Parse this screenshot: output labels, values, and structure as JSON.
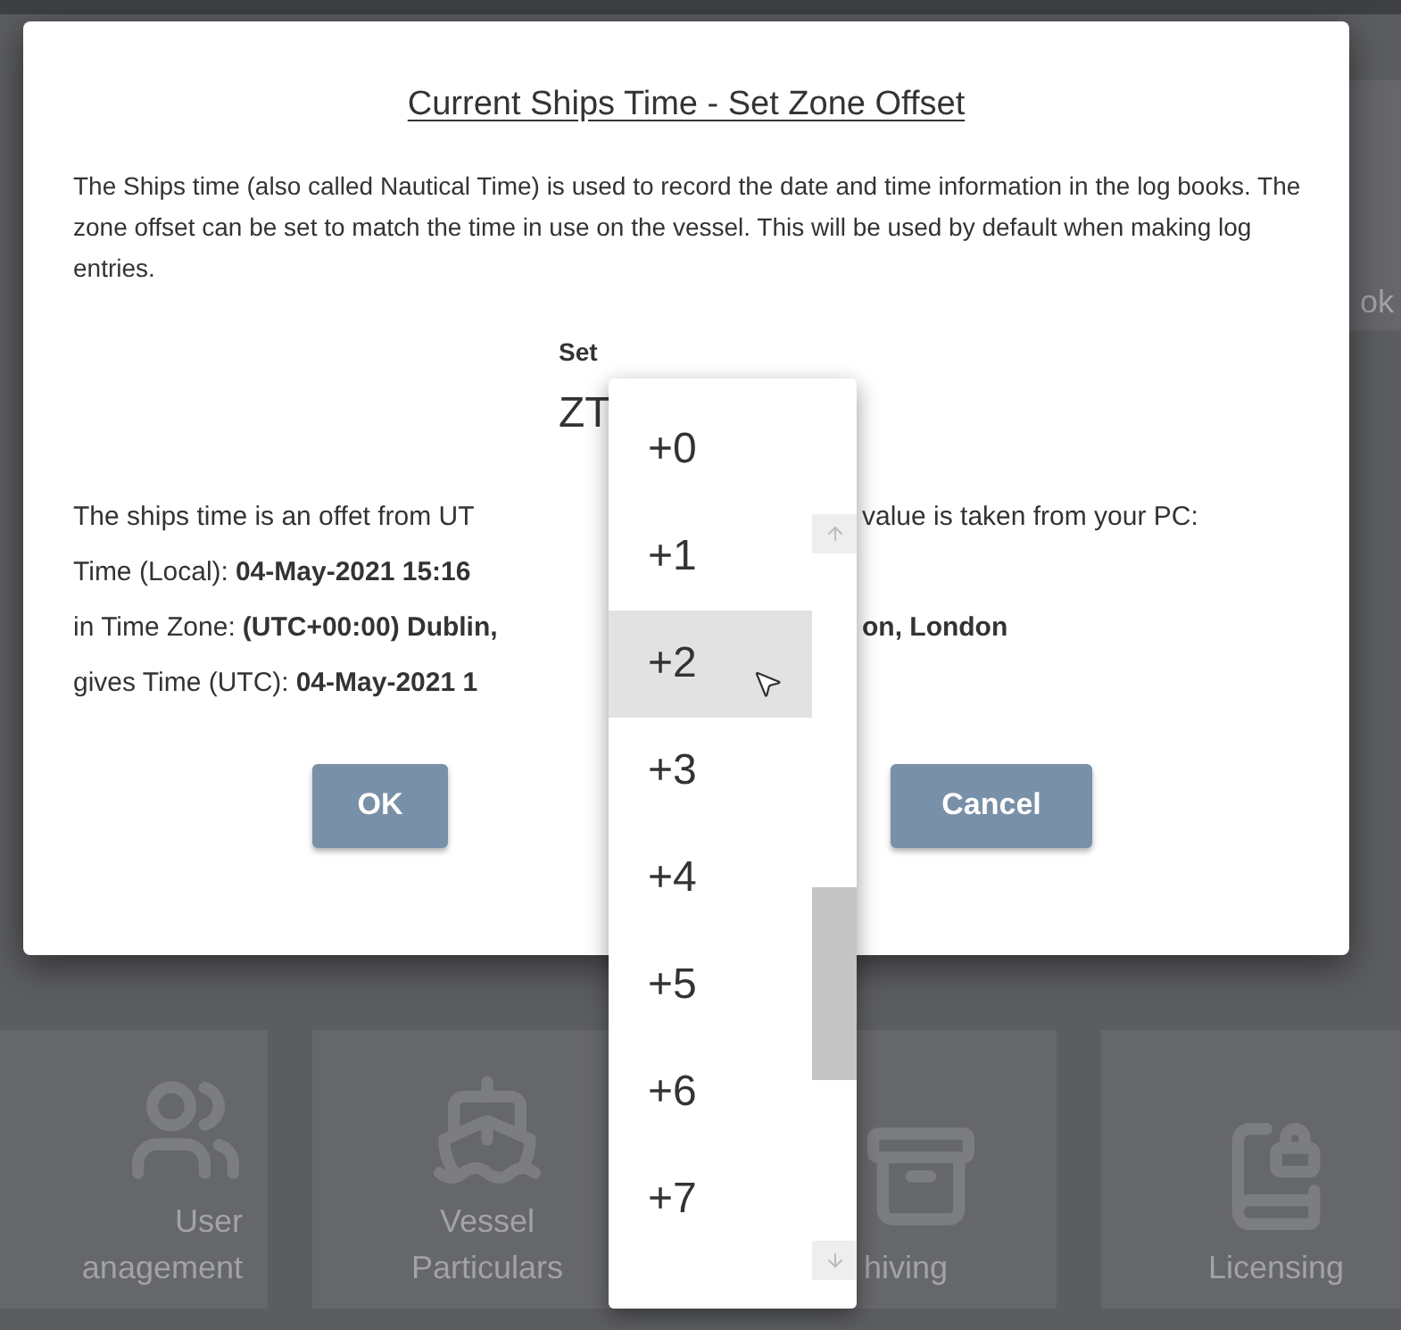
{
  "background": {
    "corner_tile": {
      "label": "ok"
    },
    "tiles": [
      {
        "kind": "users",
        "label": [
          "User",
          "anagement"
        ]
      },
      {
        "kind": "ship",
        "label": [
          "Vessel",
          "Particulars"
        ]
      },
      {
        "kind": "archive",
        "label": [
          "hiving"
        ]
      },
      {
        "kind": "licence",
        "label": [
          "Licensing"
        ]
      }
    ]
  },
  "dialog": {
    "title": "Current Ships Time - Set Zone Offset",
    "description": "The Ships time (also called Nautical Time) is used to record the date and time information in the log books. The zone offset can be set to match the time in use on the vessel. This will be used by default when making log entries.",
    "zone_label": "Set",
    "zone_prefix": "ZT",
    "info_rows": [
      {
        "label": "The ships time is an offet from UT",
        "trailing": "value is taken from your PC:",
        "trailing_bold": false
      },
      {
        "label": "Time (Local):",
        "value": "04-May-2021 15:16"
      },
      {
        "label": "in Time Zone:",
        "value": "(UTC+00:00) Dublin,",
        "trailing": "on, London",
        "trailing_bold": true
      },
      {
        "label": "gives Time (UTC):",
        "value": "04-May-2021 1"
      }
    ],
    "buttons": [
      "OK",
      "Cancel"
    ]
  },
  "dropdown": {
    "options": [
      {
        "label": "+0",
        "selected": false
      },
      {
        "label": "+1",
        "selected": false
      },
      {
        "label": "+2",
        "selected": true
      },
      {
        "label": "+3",
        "selected": false
      },
      {
        "label": "+4",
        "selected": false
      },
      {
        "label": "+5",
        "selected": false
      },
      {
        "label": "+6",
        "selected": false
      },
      {
        "label": "+7",
        "selected": false
      }
    ]
  }
}
